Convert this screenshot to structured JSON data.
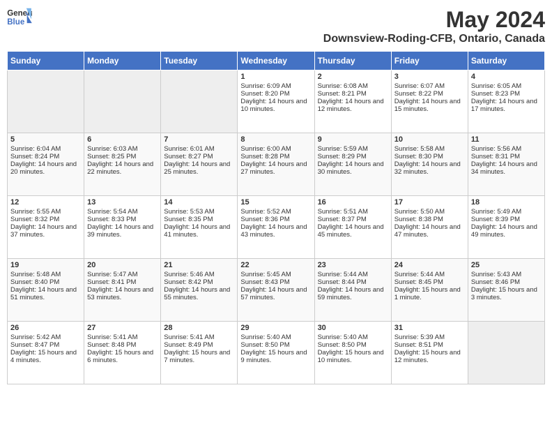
{
  "header": {
    "logo_line1": "General",
    "logo_line2": "Blue",
    "month_year": "May 2024",
    "location": "Downsview-Roding-CFB, Ontario, Canada"
  },
  "days_of_week": [
    "Sunday",
    "Monday",
    "Tuesday",
    "Wednesday",
    "Thursday",
    "Friday",
    "Saturday"
  ],
  "weeks": [
    [
      {
        "day": "",
        "empty": true
      },
      {
        "day": "",
        "empty": true
      },
      {
        "day": "",
        "empty": true
      },
      {
        "day": "1",
        "sunrise": "6:09 AM",
        "sunset": "8:20 PM",
        "daylight": "14 hours and 10 minutes."
      },
      {
        "day": "2",
        "sunrise": "6:08 AM",
        "sunset": "8:21 PM",
        "daylight": "14 hours and 12 minutes."
      },
      {
        "day": "3",
        "sunrise": "6:07 AM",
        "sunset": "8:22 PM",
        "daylight": "14 hours and 15 minutes."
      },
      {
        "day": "4",
        "sunrise": "6:05 AM",
        "sunset": "8:23 PM",
        "daylight": "14 hours and 17 minutes."
      }
    ],
    [
      {
        "day": "5",
        "sunrise": "6:04 AM",
        "sunset": "8:24 PM",
        "daylight": "14 hours and 20 minutes."
      },
      {
        "day": "6",
        "sunrise": "6:03 AM",
        "sunset": "8:25 PM",
        "daylight": "14 hours and 22 minutes."
      },
      {
        "day": "7",
        "sunrise": "6:01 AM",
        "sunset": "8:27 PM",
        "daylight": "14 hours and 25 minutes."
      },
      {
        "day": "8",
        "sunrise": "6:00 AM",
        "sunset": "8:28 PM",
        "daylight": "14 hours and 27 minutes."
      },
      {
        "day": "9",
        "sunrise": "5:59 AM",
        "sunset": "8:29 PM",
        "daylight": "14 hours and 30 minutes."
      },
      {
        "day": "10",
        "sunrise": "5:58 AM",
        "sunset": "8:30 PM",
        "daylight": "14 hours and 32 minutes."
      },
      {
        "day": "11",
        "sunrise": "5:56 AM",
        "sunset": "8:31 PM",
        "daylight": "14 hours and 34 minutes."
      }
    ],
    [
      {
        "day": "12",
        "sunrise": "5:55 AM",
        "sunset": "8:32 PM",
        "daylight": "14 hours and 37 minutes."
      },
      {
        "day": "13",
        "sunrise": "5:54 AM",
        "sunset": "8:33 PM",
        "daylight": "14 hours and 39 minutes."
      },
      {
        "day": "14",
        "sunrise": "5:53 AM",
        "sunset": "8:35 PM",
        "daylight": "14 hours and 41 minutes."
      },
      {
        "day": "15",
        "sunrise": "5:52 AM",
        "sunset": "8:36 PM",
        "daylight": "14 hours and 43 minutes."
      },
      {
        "day": "16",
        "sunrise": "5:51 AM",
        "sunset": "8:37 PM",
        "daylight": "14 hours and 45 minutes."
      },
      {
        "day": "17",
        "sunrise": "5:50 AM",
        "sunset": "8:38 PM",
        "daylight": "14 hours and 47 minutes."
      },
      {
        "day": "18",
        "sunrise": "5:49 AM",
        "sunset": "8:39 PM",
        "daylight": "14 hours and 49 minutes."
      }
    ],
    [
      {
        "day": "19",
        "sunrise": "5:48 AM",
        "sunset": "8:40 PM",
        "daylight": "14 hours and 51 minutes."
      },
      {
        "day": "20",
        "sunrise": "5:47 AM",
        "sunset": "8:41 PM",
        "daylight": "14 hours and 53 minutes."
      },
      {
        "day": "21",
        "sunrise": "5:46 AM",
        "sunset": "8:42 PM",
        "daylight": "14 hours and 55 minutes."
      },
      {
        "day": "22",
        "sunrise": "5:45 AM",
        "sunset": "8:43 PM",
        "daylight": "14 hours and 57 minutes."
      },
      {
        "day": "23",
        "sunrise": "5:44 AM",
        "sunset": "8:44 PM",
        "daylight": "14 hours and 59 minutes."
      },
      {
        "day": "24",
        "sunrise": "5:44 AM",
        "sunset": "8:45 PM",
        "daylight": "15 hours and 1 minute."
      },
      {
        "day": "25",
        "sunrise": "5:43 AM",
        "sunset": "8:46 PM",
        "daylight": "15 hours and 3 minutes."
      }
    ],
    [
      {
        "day": "26",
        "sunrise": "5:42 AM",
        "sunset": "8:47 PM",
        "daylight": "15 hours and 4 minutes."
      },
      {
        "day": "27",
        "sunrise": "5:41 AM",
        "sunset": "8:48 PM",
        "daylight": "15 hours and 6 minutes."
      },
      {
        "day": "28",
        "sunrise": "5:41 AM",
        "sunset": "8:49 PM",
        "daylight": "15 hours and 7 minutes."
      },
      {
        "day": "29",
        "sunrise": "5:40 AM",
        "sunset": "8:50 PM",
        "daylight": "15 hours and 9 minutes."
      },
      {
        "day": "30",
        "sunrise": "5:40 AM",
        "sunset": "8:50 PM",
        "daylight": "15 hours and 10 minutes."
      },
      {
        "day": "31",
        "sunrise": "5:39 AM",
        "sunset": "8:51 PM",
        "daylight": "15 hours and 12 minutes."
      },
      {
        "day": "",
        "empty": true
      }
    ]
  ]
}
